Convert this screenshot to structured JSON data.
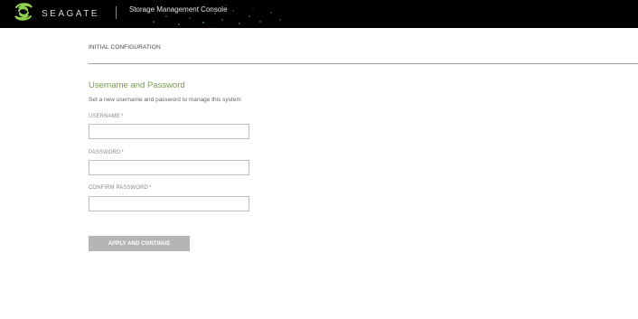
{
  "header": {
    "brand": "SEAGATE",
    "app_title": "Storage Management Console",
    "logo_icon": "seagate-swirl-icon",
    "accent_color": "#7fbf3f"
  },
  "page": {
    "breadcrumb": "INITIAL CONFIGURATION",
    "section_title": "Username and Password",
    "section_description": "Set a new username and password to manage this system"
  },
  "form": {
    "username": {
      "label": "USERNAME",
      "required_mark": "*",
      "value": "",
      "placeholder": ""
    },
    "password": {
      "label": "PASSWORD",
      "required_mark": "*",
      "value": "",
      "placeholder": ""
    },
    "confirm_password": {
      "label": "CONFIRM PASSWORD",
      "required_mark": "*",
      "value": "",
      "placeholder": ""
    },
    "submit_label": "APPLY AND CONTINUE"
  }
}
